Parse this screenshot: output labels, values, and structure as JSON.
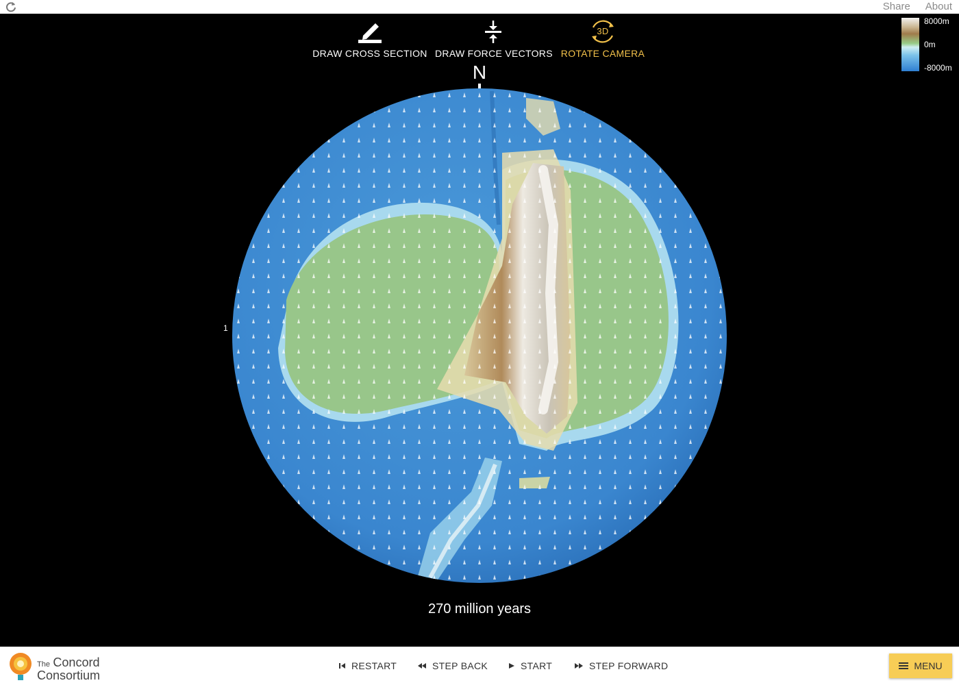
{
  "top_links": {
    "share": "Share",
    "about": "About"
  },
  "toolbar": {
    "cross_section": "DRAW CROSS SECTION",
    "force_vectors": "DRAW FORCE VECTORS",
    "rotate_camera": "ROTATE CAMERA",
    "rotate_icon_text": "3D",
    "active_color": "#f2c14a"
  },
  "legend": {
    "max": "8000m",
    "mid": "0m",
    "min": "-8000m"
  },
  "globe": {
    "north": "N",
    "lat_marker": "1"
  },
  "time": "270 million years",
  "controls": {
    "restart": "RESTART",
    "step_back": "STEP BACK",
    "start": "START",
    "step_forward": "STEP FORWARD",
    "menu": "MENU"
  },
  "logo": {
    "the": "The",
    "line1": "Concord",
    "line2": "Consortium"
  },
  "colors": {
    "ocean": "#3d8fd6",
    "land": "#98c68a",
    "mountain": "#e3e0d8",
    "menu": "#f7cd56"
  }
}
